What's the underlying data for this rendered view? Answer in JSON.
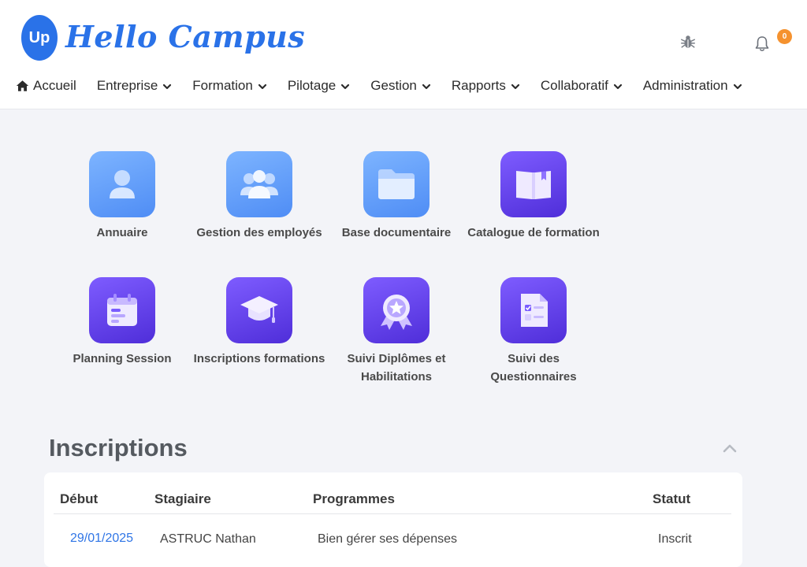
{
  "brand": {
    "badge": "Up",
    "name": "Hello Campus"
  },
  "notifications": {
    "count": "0"
  },
  "nav": {
    "items": [
      {
        "label": "Accueil",
        "icon": "home-icon"
      },
      {
        "label": "Entreprise"
      },
      {
        "label": "Formation"
      },
      {
        "label": "Pilotage"
      },
      {
        "label": "Gestion"
      },
      {
        "label": "Rapports"
      },
      {
        "label": "Collaboratif"
      },
      {
        "label": "Administration"
      }
    ]
  },
  "tiles": [
    {
      "label": "Annuaire",
      "icon": "user-icon",
      "color": "#5b98f8"
    },
    {
      "label": "Gestion des employés",
      "icon": "users-group-icon",
      "color": "#5b98f8"
    },
    {
      "label": "Base documentaire",
      "icon": "folder-icon",
      "color": "#5b98f8"
    },
    {
      "label": "Catalogue de formation",
      "icon": "book-icon",
      "color": "#6a45f0"
    },
    {
      "label": "Planning Session",
      "icon": "calendar-icon",
      "color": "#6a45f0"
    },
    {
      "label": "Inscriptions formations",
      "icon": "graduation-cap-icon",
      "color": "#6a45f0"
    },
    {
      "label": "Suivi Diplômes et Habilitations",
      "icon": "badge-star-icon",
      "color": "#6a45f0"
    },
    {
      "label": "Suivi des Questionnaires",
      "icon": "checklist-icon",
      "color": "#6a45f0"
    }
  ],
  "inscriptions": {
    "title": "Inscriptions",
    "columns": [
      "Début",
      "Stagiaire",
      "Programmes",
      "Statut"
    ],
    "rows": [
      {
        "debut": "29/01/2025",
        "stagiaire": "ASTRUC Nathan",
        "programme": "Bien gérer ses dépenses",
        "statut": "Inscrit"
      }
    ]
  },
  "colors": {
    "accent": "#2a72e8",
    "badge": "#f5922f",
    "tile_blue": "#5b98f8",
    "tile_purple": "#6a45f0"
  }
}
